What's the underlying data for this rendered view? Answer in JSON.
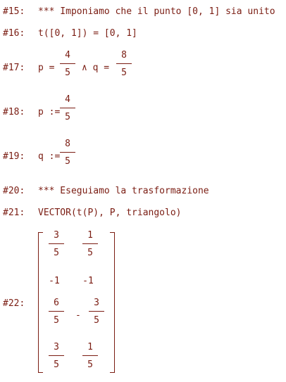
{
  "lines": {
    "l15": {
      "label": "#15:",
      "text": "*** Imponiamo che il punto [0, 1] sia unito"
    },
    "l16": {
      "label": "#16:",
      "text": "t([0, 1]) = [0, 1]"
    },
    "l17": {
      "label": "#17:",
      "p_eq": "p =",
      "and_q": "∧ q =",
      "p_num": "4",
      "p_den": "5",
      "q_num": "8",
      "q_den": "5"
    },
    "l18": {
      "label": "#18:",
      "p_def": "p :=",
      "num": "4",
      "den": "5"
    },
    "l19": {
      "label": "#19:",
      "q_def": "q :=",
      "num": "8",
      "den": "5"
    },
    "l20": {
      "label": "#20:",
      "text": "*** Eseguiamo la trasformazione"
    },
    "l21": {
      "label": "#21:",
      "text": "VECTOR(t(P), P, triangolo)"
    },
    "l22": {
      "label": "#22:",
      "r1c1_num": "3",
      "r1c1_den": "5",
      "r1c2_num": "1",
      "r1c2_den": "5",
      "r2c1": "-1",
      "r2c2": "-1",
      "r3c1_num": "6",
      "r3c1_den": "5",
      "r3c2_sign": "-",
      "r3c2_num": "3",
      "r3c2_den": "5",
      "r4c1_num": "3",
      "r4c1_den": "5",
      "r4c2_num": "1",
      "r4c2_den": "5"
    }
  }
}
